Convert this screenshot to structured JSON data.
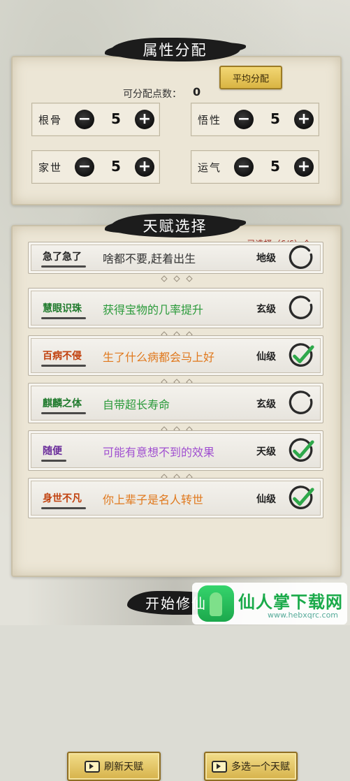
{
  "attributes_panel": {
    "title": "属性分配",
    "points_label": "可分配点数：",
    "points_value": "0",
    "distribute_button": "平均分配",
    "items": [
      {
        "name": "根骨",
        "value": "5"
      },
      {
        "name": "悟性",
        "value": "5"
      },
      {
        "name": "家世",
        "value": "5"
      },
      {
        "name": "运气",
        "value": "5"
      }
    ],
    "minus_symbol": "−",
    "plus_symbol": "+"
  },
  "talent_panel": {
    "title": "天赋选择",
    "selected_count": "已选择（6/6）个",
    "talents": [
      {
        "name": "急了急了",
        "desc": "啥都不要,赶着出生",
        "grade": "地级",
        "name_color": "#222222",
        "desc_color": "#333333",
        "selected": false
      },
      {
        "name": "慧眼识珠",
        "desc": "获得宝物的几率提升",
        "grade": "玄级",
        "name_color": "#1f7a2c",
        "desc_color": "#2a9a3a",
        "selected": false
      },
      {
        "name": "百病不侵",
        "desc": "生了什么病都会马上好",
        "grade": "仙级",
        "name_color": "#c1410e",
        "desc_color": "#e0781c",
        "selected": true
      },
      {
        "name": "麒麟之体",
        "desc": "自带超长寿命",
        "grade": "玄级",
        "name_color": "#1f7a2c",
        "desc_color": "#2a9a3a",
        "selected": false
      },
      {
        "name": "随便",
        "desc": "可能有意想不到的效果",
        "grade": "天级",
        "name_color": "#6a2c9a",
        "desc_color": "#a04fd0",
        "selected": true
      },
      {
        "name": "身世不凡",
        "desc": "你上辈子是名人转世",
        "grade": "仙级",
        "name_color": "#c1410e",
        "desc_color": "#e0781c",
        "selected": true
      }
    ]
  },
  "buttons": {
    "refresh": "刷新天赋",
    "extra_pick": "多选一个天赋",
    "start": "开始修仙"
  },
  "watermark": {
    "title": "仙人掌下载网",
    "url": "www.hebxqrc.com"
  },
  "icons": {
    "check": "check-icon",
    "empty": "empty-circle-icon",
    "video": "video-icon"
  }
}
